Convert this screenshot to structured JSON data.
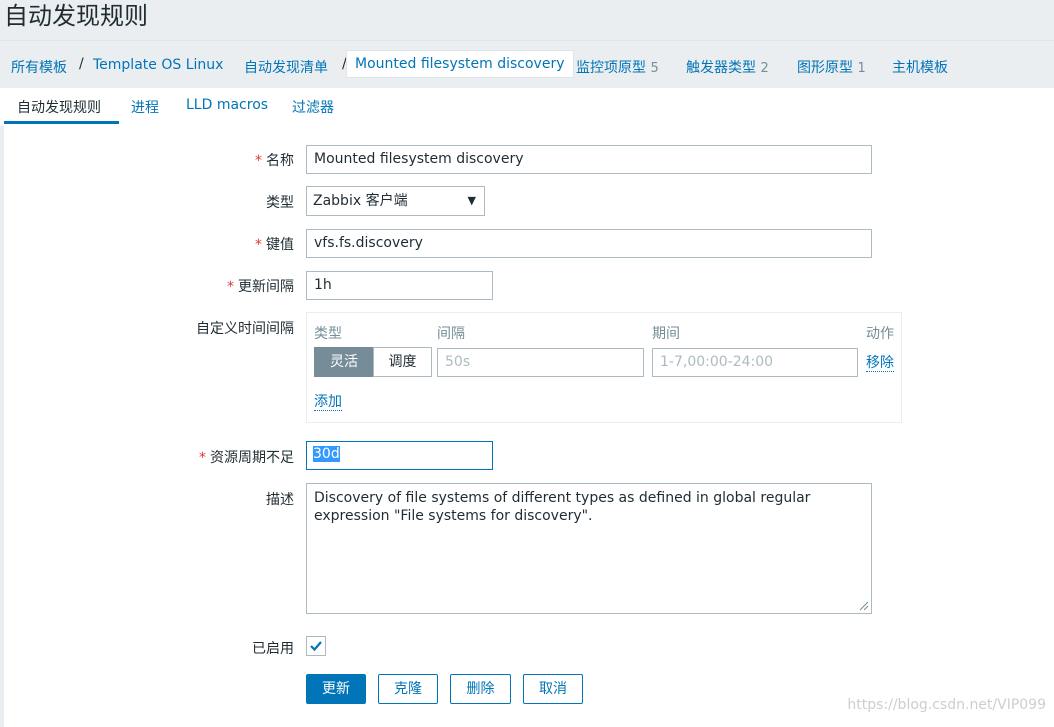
{
  "page": {
    "title": "自动发现规则"
  },
  "breadcrumb": {
    "all_templates": "所有模板",
    "template": "Template OS Linux",
    "discovery_list": "自动发现清单",
    "current": "Mounted filesystem discovery",
    "item_prototypes": {
      "label": "监控项原型",
      "count": "5"
    },
    "trigger_prototypes": {
      "label": "触发器类型",
      "count": "2"
    },
    "graph_prototypes": {
      "label": "图形原型",
      "count": "1"
    },
    "host_templates": "主机模板",
    "separator": "/"
  },
  "tabs": [
    {
      "label": "自动发现规则",
      "active": true
    },
    {
      "label": "进程",
      "active": false
    },
    {
      "label": "LLD macros",
      "active": false
    },
    {
      "label": "过滤器",
      "active": false
    }
  ],
  "form": {
    "required_mark": "*",
    "name": {
      "label": "名称",
      "value": "Mounted filesystem discovery"
    },
    "type": {
      "label": "类型",
      "value": "Zabbix 客户端",
      "arrow": "▼"
    },
    "key": {
      "label": "键值",
      "value": "vfs.fs.discovery"
    },
    "update_interval": {
      "label": "更新间隔",
      "value": "1h"
    },
    "custom_intervals": {
      "label": "自定义时间间隔",
      "headers": {
        "type": "类型",
        "interval": "间隔",
        "period": "期间",
        "action": "动作"
      },
      "row": {
        "flexible": "灵活",
        "scheduling": "调度",
        "interval_placeholder": "50s",
        "period_placeholder": "1-7,00:00-24:00",
        "remove": "移除"
      },
      "add": "添加"
    },
    "keep_lost": {
      "label": "资源周期不足",
      "value": "30d"
    },
    "description": {
      "label": "描述",
      "value": "Discovery of file systems of different types as defined in global regular expression \"File systems for discovery\"."
    },
    "enabled": {
      "label": "已启用",
      "checked": true
    }
  },
  "buttons": {
    "update": "更新",
    "clone": "克隆",
    "delete": "删除",
    "cancel": "取消"
  },
  "watermark": "https://blog.csdn.net/VIP099",
  "colors": {
    "accent": "#0275b8",
    "required": "#e33734",
    "segment_active": "#768d99"
  }
}
